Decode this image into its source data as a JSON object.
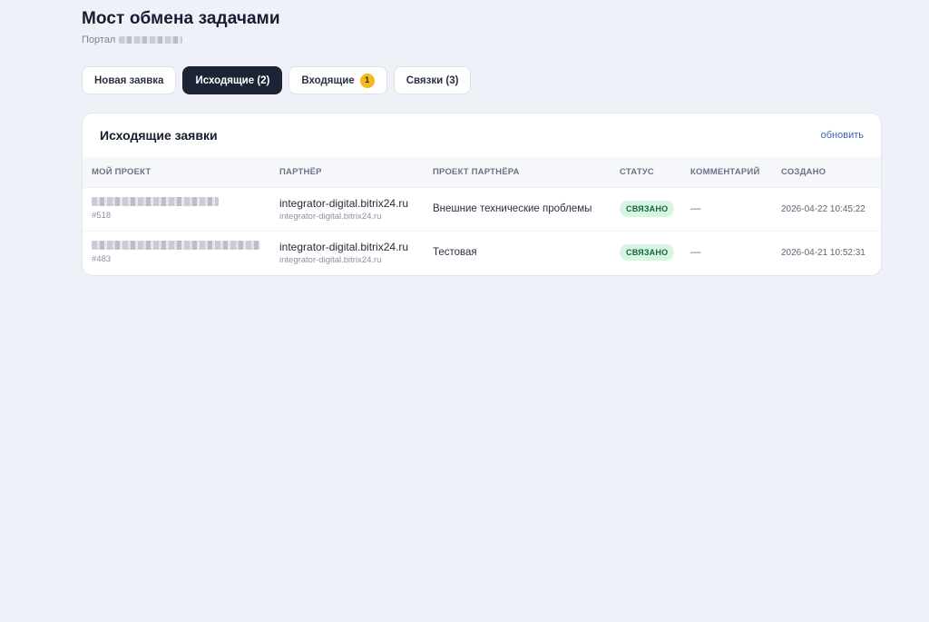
{
  "header": {
    "title": "Мост обмена задачами",
    "portal_label": "Портал"
  },
  "tabs": [
    {
      "label": "Новая заявка",
      "active": false
    },
    {
      "label": "Исходящие (2)",
      "active": true
    },
    {
      "label": "Входящие",
      "active": false,
      "badge": "1"
    },
    {
      "label": "Связки (3)",
      "active": false
    }
  ],
  "card": {
    "title": "Исходящие заявки",
    "refresh_label": "обновить",
    "columns": [
      "Мой проект",
      "Партнёр",
      "Проект партнёра",
      "Статус",
      "Комментарий",
      "Создано"
    ],
    "rows": [
      {
        "project_id": "#518",
        "partner": "integrator-digital.bitrix24.ru",
        "partner_sub": "integrator-digital.bitrix24.ru",
        "partner_project": "Внешние технические проблемы",
        "status": "СВЯЗАНО",
        "comment": "—",
        "created": "2026-04-22 10:45:22"
      },
      {
        "project_id": "#483",
        "partner": "integrator-digital.bitrix24.ru",
        "partner_sub": "integrator-digital.bitrix24.ru",
        "partner_project": "Тестовая",
        "status": "СВЯЗАНО",
        "comment": "—",
        "created": "2026-04-21 10:52:31"
      }
    ]
  },
  "colors": {
    "background": "#eef2f8",
    "active_tab": "#1c2436",
    "badge": "#f5b820",
    "status_bg": "#d7f5e3",
    "status_text": "#0f6a37",
    "link": "#3d63b8"
  }
}
